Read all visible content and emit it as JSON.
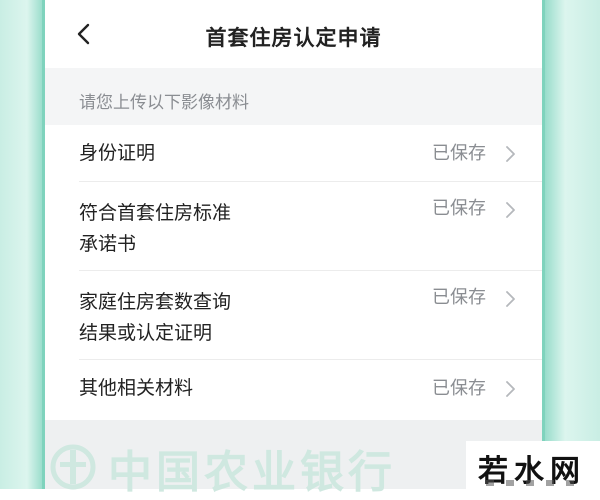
{
  "header": {
    "title": "首套住房认定申请",
    "back_icon": "chevron-left-icon"
  },
  "section": {
    "hint": "请您上传以下影像材料"
  },
  "items": [
    {
      "label_lines": [
        "身份证明"
      ],
      "status": "已保存"
    },
    {
      "label_lines": [
        "符合首套住房标准",
        "承诺书"
      ],
      "status": "已保存"
    },
    {
      "label_lines": [
        "家庭住房套数查询",
        "结果或认定证明"
      ],
      "status": "已保存"
    },
    {
      "label_lines": [
        "其他相关材料"
      ],
      "status": "已保存"
    }
  ],
  "footer": {
    "bank_name": "中国农业银行"
  },
  "watermark": {
    "text": "若水网"
  },
  "colors": {
    "frame": "#c9eee4",
    "status_gray": "#8a8d92",
    "bank_faded": "#cfe8e0"
  }
}
